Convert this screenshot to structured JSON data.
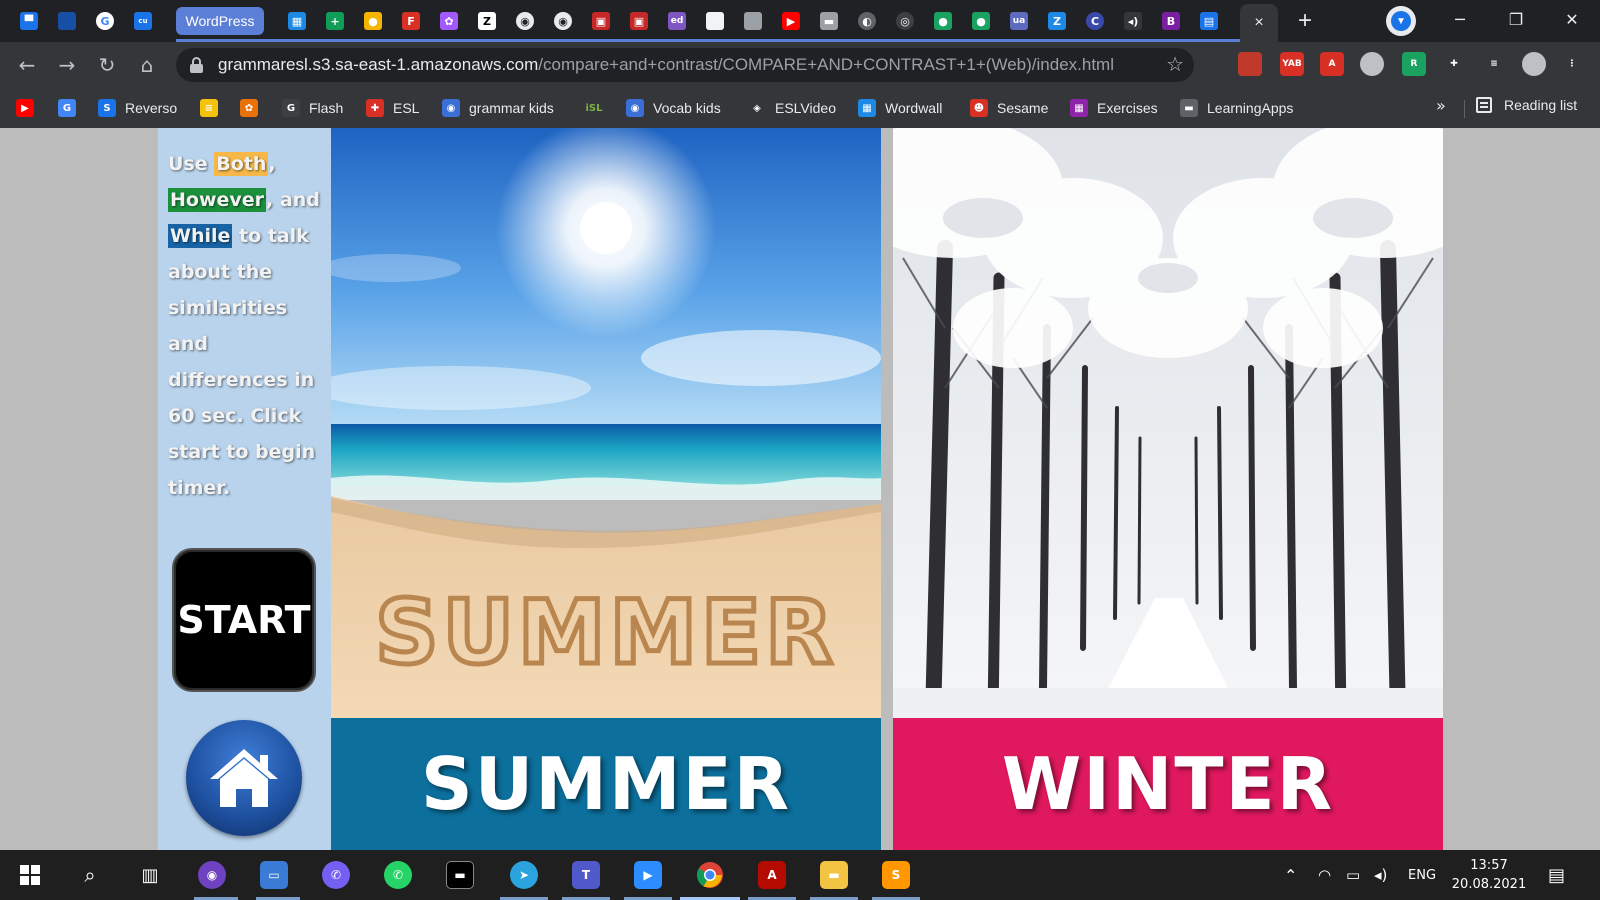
{
  "browser": {
    "tab_group_label": "WordPress",
    "active_tab_close": "×",
    "new_tab": "+",
    "window_controls": {
      "minimize": "─",
      "restore": "❐",
      "close": "✕"
    },
    "url_host": "grammaresl.s3.sa-east-1.amazonaws.com",
    "url_path": "/compare+and+contrast/COMPARE+AND+CONTRAST+1+(Web)/index.html",
    "extensions": [
      {
        "name": "red-bookmark-icon",
        "color": "#c0392b",
        "text": ""
      },
      {
        "name": "yab-icon",
        "color": "#d93025",
        "text": "YAB"
      },
      {
        "name": "acrobat-icon",
        "color": "#d93025",
        "text": "A"
      },
      {
        "name": "shield-icon",
        "color": "#bdc1c6",
        "text": ""
      },
      {
        "name": "green-ext-icon",
        "color": "#1aa260",
        "text": "R"
      },
      {
        "name": "puzzle-icon",
        "color": "#35363a",
        "text": "✚"
      },
      {
        "name": "media-icon",
        "color": "#35363a",
        "text": "≡"
      },
      {
        "name": "account-icon",
        "color": "#bdc1c6",
        "text": ""
      },
      {
        "name": "menu-icon",
        "color": "#35363a",
        "text": "⋮"
      }
    ]
  },
  "bookmarks": {
    "items": [
      {
        "label": "",
        "icon": "youtube-icon",
        "color": "#ff0000",
        "glyph": "▶"
      },
      {
        "label": "",
        "icon": "google-translate-icon",
        "color": "#4285f4",
        "glyph": "G"
      },
      {
        "label": "Reverso",
        "icon": "reverso-icon",
        "color": "#1a73e8",
        "glyph": "S"
      },
      {
        "label": "",
        "icon": "yellow-icon",
        "color": "#f4c20d",
        "glyph": "≡"
      },
      {
        "label": "",
        "icon": "colorful-icon",
        "color": "#e8710a",
        "glyph": "✿"
      },
      {
        "label": "Flash",
        "icon": "flash-icon",
        "color": "#3c4043",
        "glyph": "G"
      },
      {
        "label": "ESL",
        "icon": "esl-icon",
        "color": "#d93025",
        "glyph": "✚"
      },
      {
        "label": "grammar kids",
        "icon": "globe-icon",
        "color": "#3b6fd8",
        "glyph": "◉"
      },
      {
        "label": "",
        "icon": "isl-icon",
        "color": "#35363a",
        "glyph": "iSL"
      },
      {
        "label": "Vocab kids",
        "icon": "globe-icon",
        "color": "#3b6fd8",
        "glyph": "◉"
      },
      {
        "label": "ESLVideo",
        "icon": "eslvideo-icon",
        "color": "#35363a",
        "glyph": "◈"
      },
      {
        "label": "Wordwall",
        "icon": "wordwall-icon",
        "color": "#1e88e5",
        "glyph": "▦"
      },
      {
        "label": "Sesame",
        "icon": "sesame-icon",
        "color": "#d93025",
        "glyph": "☻"
      },
      {
        "label": "Exercises",
        "icon": "exercises-icon",
        "color": "#8e24aa",
        "glyph": "▦"
      },
      {
        "label": "LearningApps",
        "icon": "learningapps-icon",
        "color": "#5f6368",
        "glyph": "▬"
      }
    ],
    "more": "»",
    "reading_list": "Reading list"
  },
  "page": {
    "instructions": {
      "word_use": "Use",
      "word_both": "Both",
      "sep1": ",",
      "word_however": "However",
      "sep2": ", and",
      "word_while": "While",
      "rest": "to talk about the similarities and differences in 60 sec. Click start to begin timer."
    },
    "start_label": "START",
    "panels": {
      "summer_label": "SUMMER",
      "winter_label": "WINTER",
      "sand_writing": "SUMMER",
      "colors": {
        "summer_band": "#0c6f9c",
        "winter_band": "#e0185e"
      }
    }
  },
  "taskbar": {
    "tray_lang": "ENG",
    "time": "13:57",
    "date": "20.08.2021"
  }
}
